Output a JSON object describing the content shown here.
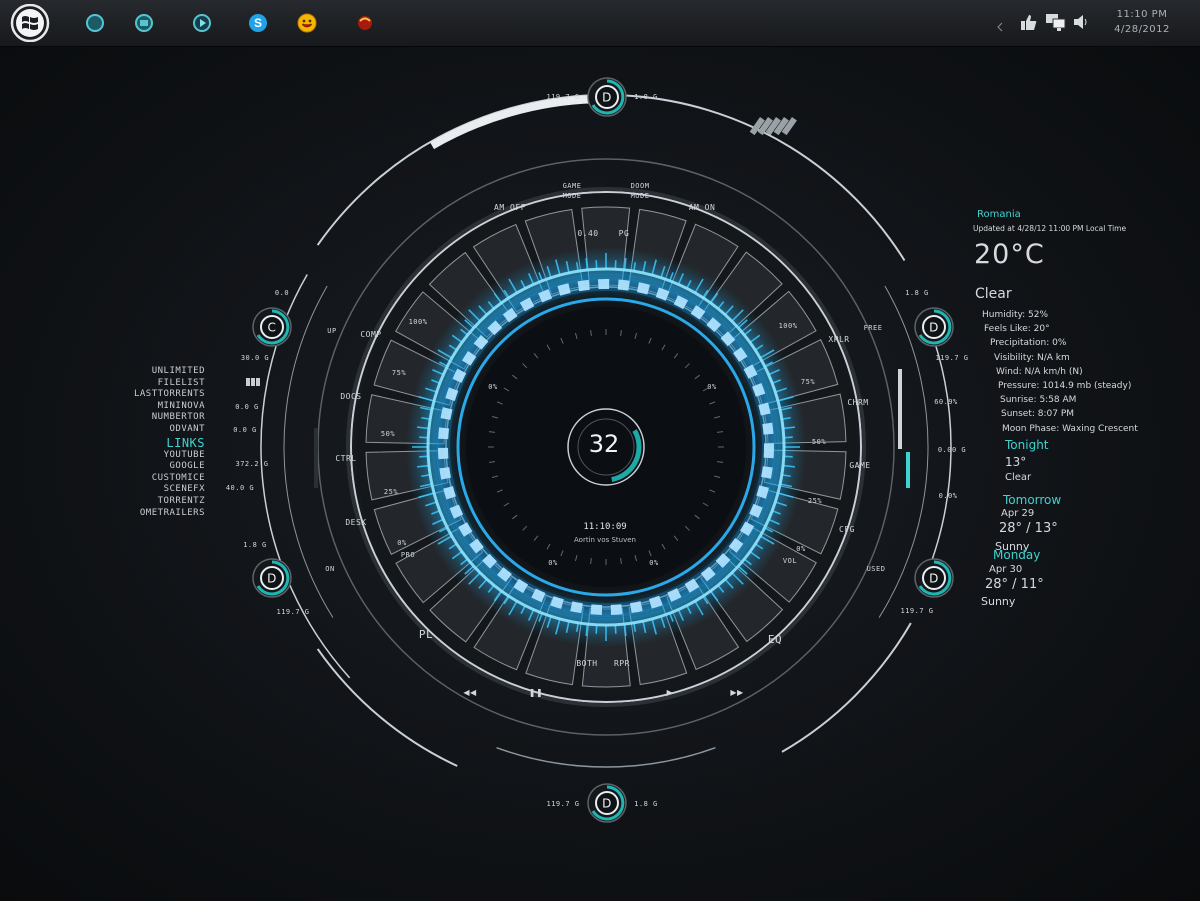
{
  "taskbar": {
    "clock_time": "11:10 PM",
    "clock_date": "4/28/2012",
    "pinned": [
      {
        "name": "app-circle-1"
      },
      {
        "name": "app-circle-2"
      },
      {
        "name": "media-player"
      },
      {
        "name": "skype"
      },
      {
        "name": "messenger"
      },
      {
        "name": "app-red"
      }
    ]
  },
  "ring": {
    "top_value_left": "119.7 G",
    "top_value_right": "1.8 G",
    "bottom_value_left": "119.7 G",
    "bottom_value_right": "1.8 G",
    "left_drive_top": "0.0",
    "left_drive_bottom": "30.0 G",
    "left_drive2_top": "1.8 G",
    "left_drive2_bottom": "119.7 G",
    "right_drive_top": "1.8 G",
    "right_drive_bottom": "119.7 G",
    "right_drive2_bottom": "119.7 G",
    "drive_letters": {
      "top": "D",
      "left": "C",
      "right": "D",
      "left2": "D",
      "right2": "D",
      "bottom": "D"
    },
    "left_stats": [
      "0.0 G",
      "0.0 G",
      "372.2 G",
      "40.0 G"
    ],
    "right_stats": [
      "60.9%",
      "0.00 G",
      "0.0%"
    ],
    "buttons_top": [
      "AM OFF",
      "GAME MODE",
      "DOOM MODE",
      "AM ON"
    ],
    "buttons_left": [
      "COMP",
      "DOCS",
      "CTRL",
      "DESK"
    ],
    "buttons_right": [
      "XPLR",
      "CHRM",
      "GAME",
      "CFG"
    ],
    "side_left_labels": [
      "UP",
      "ON"
    ],
    "side_right_labels": [
      "FREE",
      "USED"
    ],
    "inner_left_percents": [
      "100%",
      "75%",
      "50%",
      "25%",
      "0%"
    ],
    "inner_right_percents": [
      "100%",
      "75%",
      "50%",
      "25%",
      "0%"
    ],
    "inner_left_label": "PRO",
    "inner_right_label": "VOL",
    "top_readout_left": "0.40",
    "top_readout_right": "PG",
    "bottom_readout_left": "BOTH",
    "bottom_readout_right": "RPR",
    "center_value": "32",
    "center_time": "11:10:09",
    "center_caption": "Aortin vos Stuven",
    "pl_label": "PL",
    "eq_label": "EQ",
    "media_buttons": [
      "rewind",
      "pause",
      "stop",
      "play",
      "fast-forward"
    ],
    "media_glyphs": [
      "◀◀",
      "❚❚",
      "",
      "▶",
      "▶▶"
    ],
    "inner_small_percents": [
      "0%",
      "0%",
      "0%",
      "0%"
    ]
  },
  "links": {
    "items": [
      "UNLIMITED",
      "FILELIST",
      "LASTTORRENTS",
      "MININOVA",
      "NUMBERTOR",
      "ODVANT"
    ],
    "header": "LINKS",
    "items2": [
      "YOUTUBE",
      "GOOGLE",
      "CUSTOMICE",
      "SCENEFX",
      "TORRENTZ",
      "OMETRAILERS"
    ]
  },
  "weather": {
    "location": "Romania",
    "updated": "Updated at 4/28/12 11:00 PM Local Time",
    "temperature": "20°C",
    "condition": "Clear",
    "details": [
      "Humidity: 52%",
      "Feels Like: 20°",
      "Precipitation: 0%",
      "Visibility: N/A km",
      "Wind: N/A km/h (N)",
      "Pressure: 1014.9 mb (steady)",
      "Sunrise: 5:58 AM",
      "Sunset: 8:07 PM",
      "Moon Phase: Waxing Crescent"
    ],
    "tonight_label": "Tonight",
    "tonight_temp": "13°",
    "tonight_cond": "Clear",
    "tomorrow_label": "Tomorrow",
    "tomorrow_date": "Apr 29",
    "tomorrow_temp": "28° / 13°",
    "tomorrow_cond": "Sunny",
    "monday_label": "Monday",
    "monday_date": "Apr 30",
    "monday_temp": "28° / 11°",
    "monday_cond": "Sunny"
  },
  "colors": {
    "accent": "#3fd3cf",
    "glow": "#19b6ff",
    "panel": "#23272b",
    "line": "#c9d0d6"
  }
}
